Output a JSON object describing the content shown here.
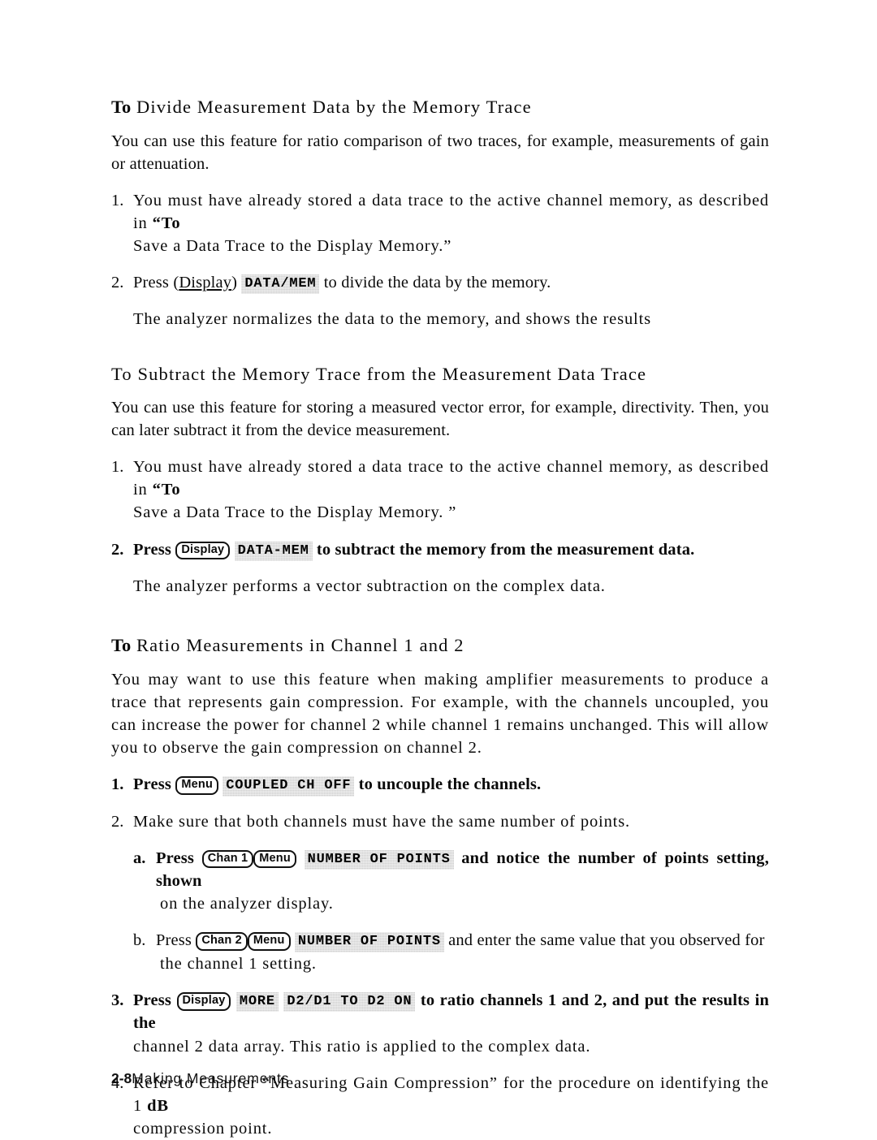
{
  "page": {
    "footer_page_number": "2-8",
    "footer_title": "Making Measurements"
  },
  "sections": [
    {
      "heading_prefix": "To",
      "heading_rest": "Divide Measurement Data by the Memory Trace",
      "intro": "You can use this feature for ratio comparison of two traces, for example, measurements of gain or  attenuation.",
      "step1_marker": "1.",
      "step1_text_a": "You must have already stored a data trace to the active channel memory, as described in ",
      "step1_quote_open": "“To",
      "step1_text_b": "Save a Data Trace to the Display Memory.”",
      "step2_marker": "2.",
      "step2_press": "Press",
      "step2_hardkey": "Display",
      "step2_softkey": "DATA/MEM",
      "step2_tail": "to divide the data by the memory.",
      "note": "The analyzer normalizes the data to the memory, and shows the results"
    },
    {
      "heading_prefix": "",
      "heading_rest": "To Subtract the Memory Trace from the Measurement Data Trace",
      "intro": "You can use this feature for storing a measured vector error, for example, directivity. Then, you can later subtract it from the device measurement.",
      "step1_marker": "1.",
      "step1_text_a": "You must have already stored a data trace to the active channel memory, as described in ",
      "step1_quote_open": "“To",
      "step1_text_b": "Save a Data Trace to the Display Memory. ”",
      "step2_marker": "2.",
      "step2_press": "Press",
      "step2_hardkey": "Display",
      "step2_softkey": "DATA-MEM",
      "step2_tail": "to subtract the memory from the measurement data.",
      "note": "The analyzer performs a vector subtraction on the complex data."
    },
    {
      "heading_prefix": "To",
      "heading_rest": "Ratio Measurements in Channel 1 and 2",
      "intro": "You may want to use this feature when making amplifier measurements to produce a trace that represents gain compression. For example, with the channels uncoupled, you can increase the power for channel 2 while channel 1 remains unchanged. This will allow you to observe the gain compression on channel 2.",
      "step1_marker": "1.",
      "step1_press": "Press",
      "step1_hardkey": "Menu",
      "step1_softkey": "COUPLED CH OFF",
      "step1_tail": "to uncouple the channels.",
      "step2_marker": "2.",
      "step2_text": "Make sure that both channels must have the same number of points.",
      "sub_a_marker": "a.",
      "sub_a_press": "Press",
      "sub_a_hardkey1": "Chan 1",
      "sub_a_hardkey2": "Menu",
      "sub_a_softkey": "NUMBER OF POINTS",
      "sub_a_tail": "and notice the number of points setting, shown",
      "sub_a_cont": "on the analyzer display.",
      "sub_b_marker": "b.",
      "sub_b_press": "Press",
      "sub_b_hardkey1": "Chan 2",
      "sub_b_hardkey2": "Menu",
      "sub_b_softkey": "NUMBER OF POINTS",
      "sub_b_tail": "and enter the same value that you observed for",
      "sub_b_cont": "the channel 1 setting.",
      "step3_marker": "3.",
      "step3_press": "Press",
      "step3_hardkey": "Display",
      "step3_softkey1": "MORE",
      "step3_softkey2": "D2/D1 TO D2 ON",
      "step3_tail": "to ratio channels 1 and 2, and put the results in the",
      "step3_cont": "channel 2 data array. This ratio is applied to the complex data.",
      "step4_marker": "4.",
      "step4_text_a": "Refer to Chapter “Measuring Gain Compression” for the procedure on identifying the 1 ",
      "step4_unit": "dB",
      "step4_cont": "compression point."
    }
  ]
}
